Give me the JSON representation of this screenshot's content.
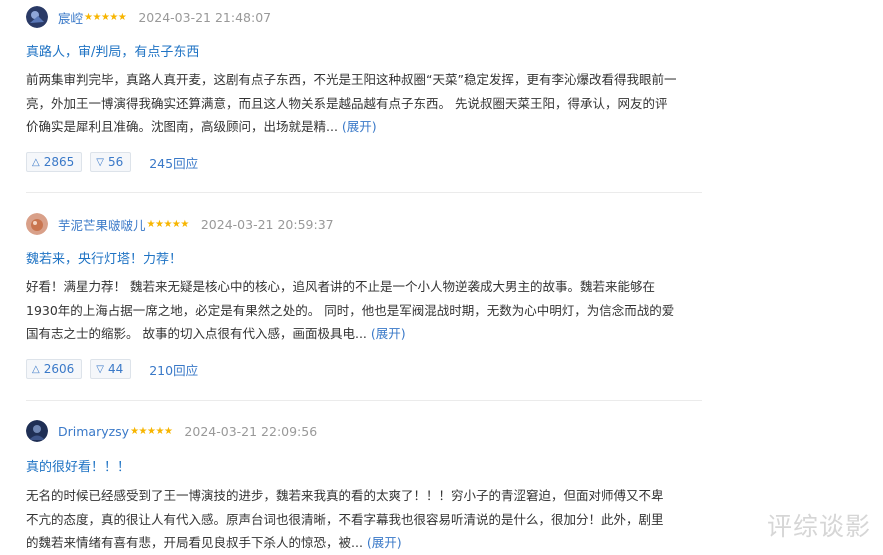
{
  "reviews": [
    {
      "username": "宸崆",
      "stars": "★★★★★",
      "date": "2024-03-21 21:48:07",
      "title": "真路人，审/判局，有点子东西",
      "lines": [
        "前两集审判完毕，真路人真开麦，这剧有点子东西，不光是王阳这种叔圈“天菜”稳定发挥，更有李沁爆改看得我眼前一",
        "亮，外加王一博演得我确实还算满意，而且这人物关系是越品越有点子东西。 先说叔圈天菜王阳，得承认，网友的评",
        "价确实是犀利且准确。沈图南，高级顾问，出场就是精..."
      ],
      "more": "(展开)",
      "up": "2865",
      "down": "56",
      "replies": "245回应"
    },
    {
      "username": "芋泥芒果啵啵儿",
      "stars": "★★★★★",
      "date": "2024-03-21 20:59:37",
      "title": "魏若来，央行灯塔！力荐！",
      "lines": [
        "好看！满星力荐！ 魏若来无疑是核心中的核心，追风者讲的不止是一个小人物逆袭成大男主的故事。魏若来能够在",
        "1930年的上海占据一席之地，必定是有果然之处的。 同时，他也是军阀混战时期，无数为心中明灯，为信念而战的爱",
        "国有志之士的缩影。 故事的切入点很有代入感，画面极具电..."
      ],
      "more": "(展开)",
      "up": "2606",
      "down": "44",
      "replies": "210回应"
    },
    {
      "username": "Drimaryzsy",
      "stars": "★★★★★",
      "date": "2024-03-21 22:09:56",
      "title": "真的很好看！！！",
      "lines": [
        "无名的时候已经感受到了王一博演技的进步，魏若来我真的看的太爽了！！！穷小子的青涩窘迫，但面对师傅又不卑",
        "不亢的态度，真的很让人有代入感。原声台词也很清晰，不看字幕我也很容易听清说的是什么，很加分！此外，剧里",
        "的魏若来情绪有喜有悲，开局看见良叔手下杀人的惊恐，被..."
      ],
      "more": "(展开)"
    }
  ],
  "icons": {
    "up": "△",
    "down": "▽"
  },
  "watermark": "评综谈影"
}
